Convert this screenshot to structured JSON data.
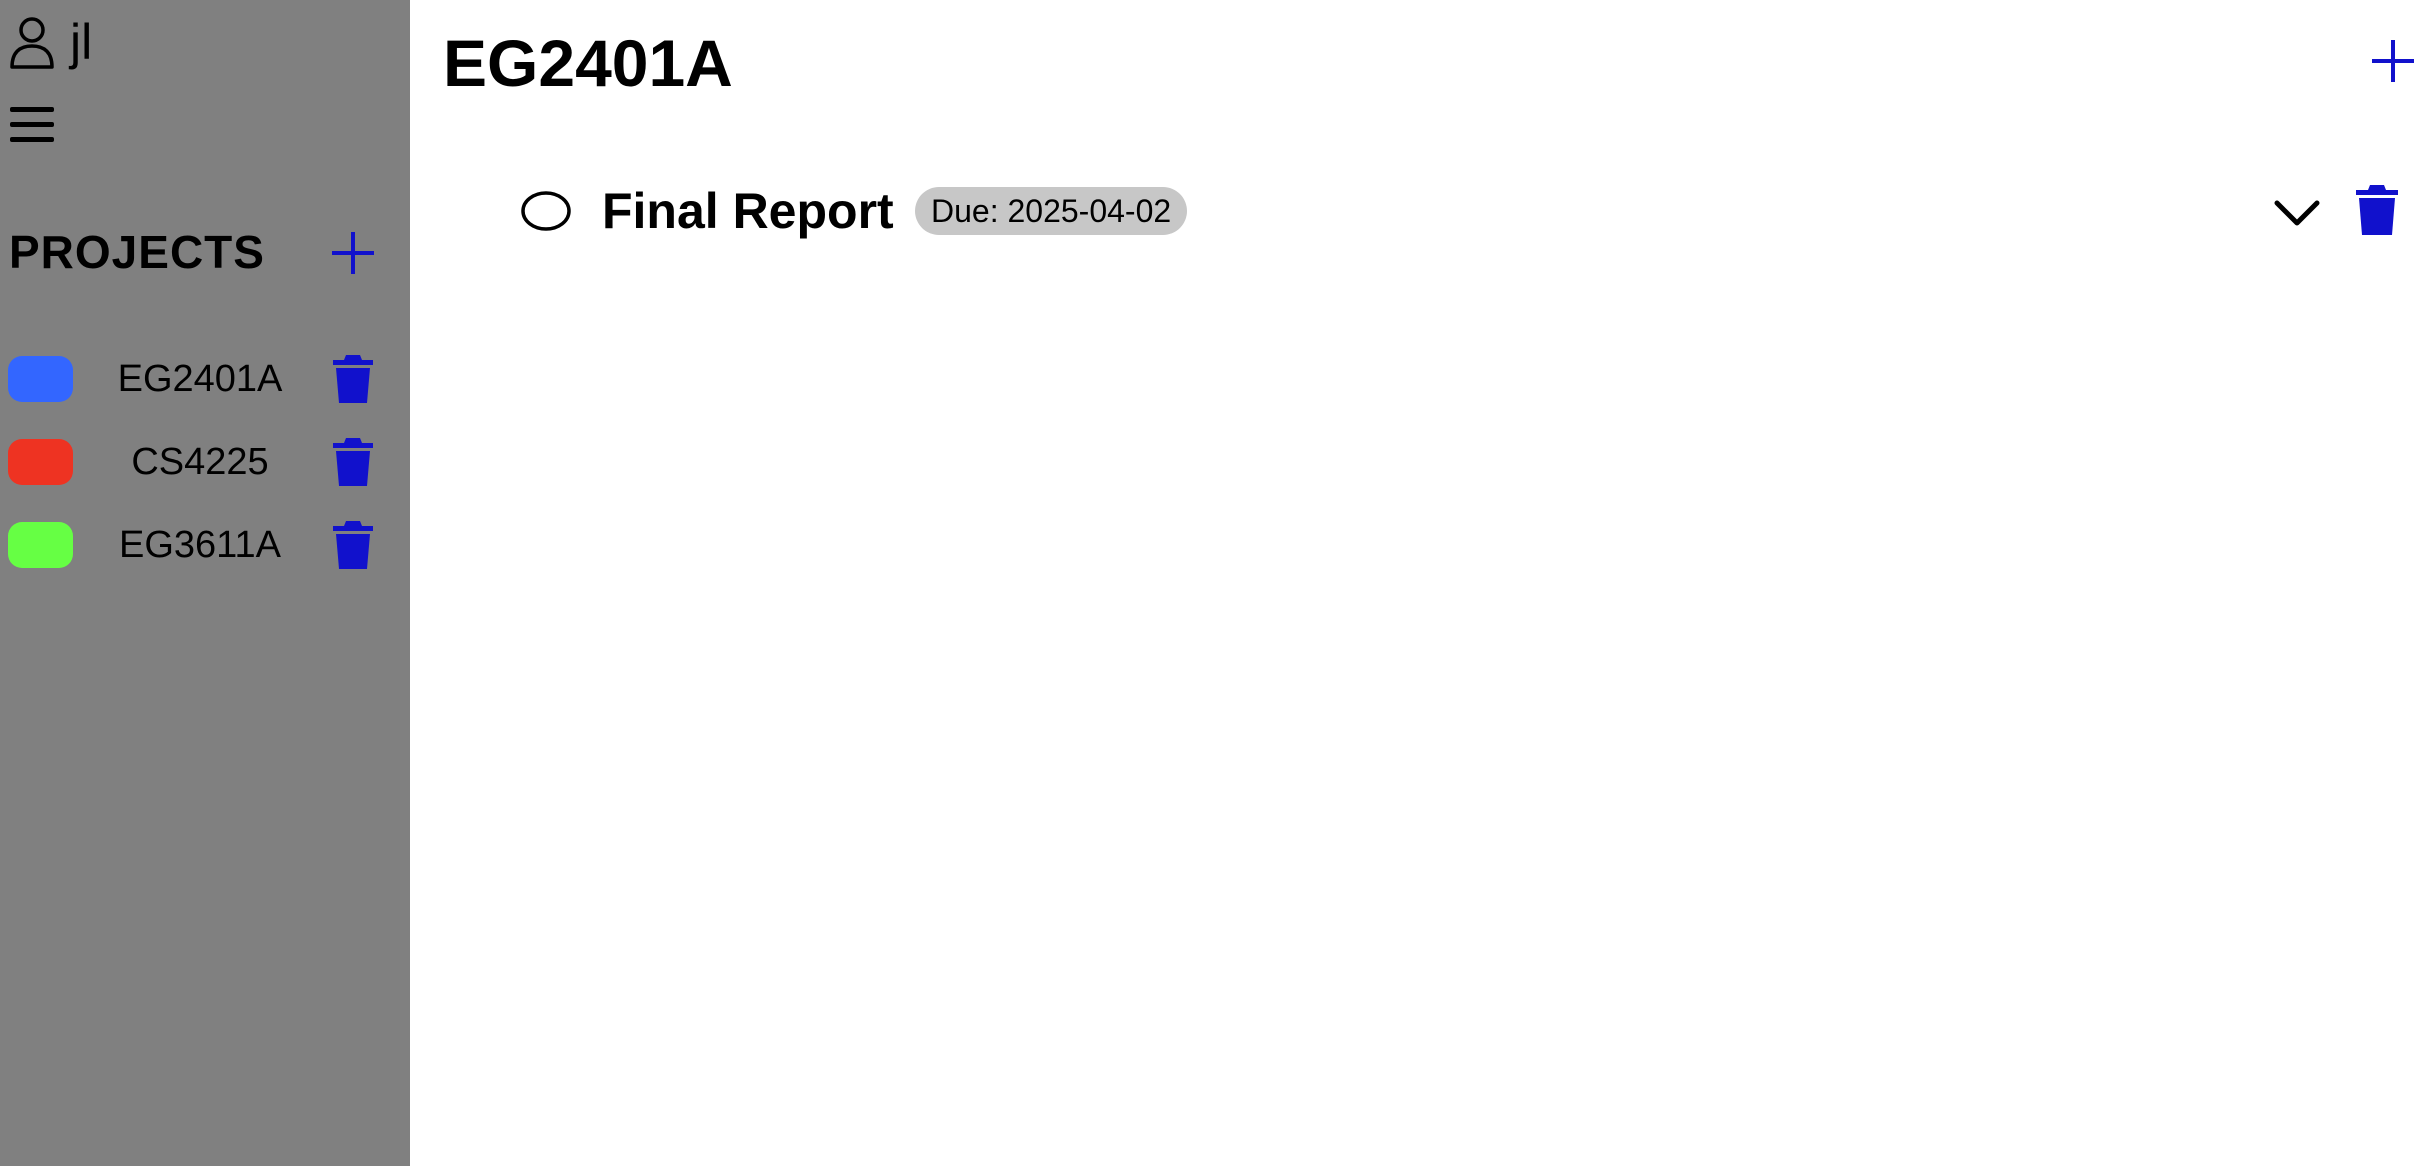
{
  "user": {
    "icon": "user-icon",
    "name": "jl"
  },
  "sidebar": {
    "menu_icon": "hamburger-menu-icon",
    "projects_heading": "PROJECTS",
    "add_icon": "plus-icon",
    "projects": [
      {
        "name": "EG2401A",
        "color": "#3366ff",
        "delete_icon": "trash-icon"
      },
      {
        "name": "CS4225",
        "color": "#ee3322",
        "delete_icon": "trash-icon"
      },
      {
        "name": "EG3611A",
        "color": "#66ff44",
        "delete_icon": "trash-icon"
      }
    ]
  },
  "main": {
    "title": "EG2401A",
    "add_icon": "plus-icon",
    "tasks": [
      {
        "title": "Final Report",
        "due": "Due: 2025-04-02",
        "completed": false,
        "expand_icon": "chevron-down-icon",
        "delete_icon": "trash-icon"
      }
    ]
  },
  "colors": {
    "sidebar_bg": "#808080",
    "accent_blue": "#1111cc",
    "badge_bg": "#c7c7c7"
  }
}
